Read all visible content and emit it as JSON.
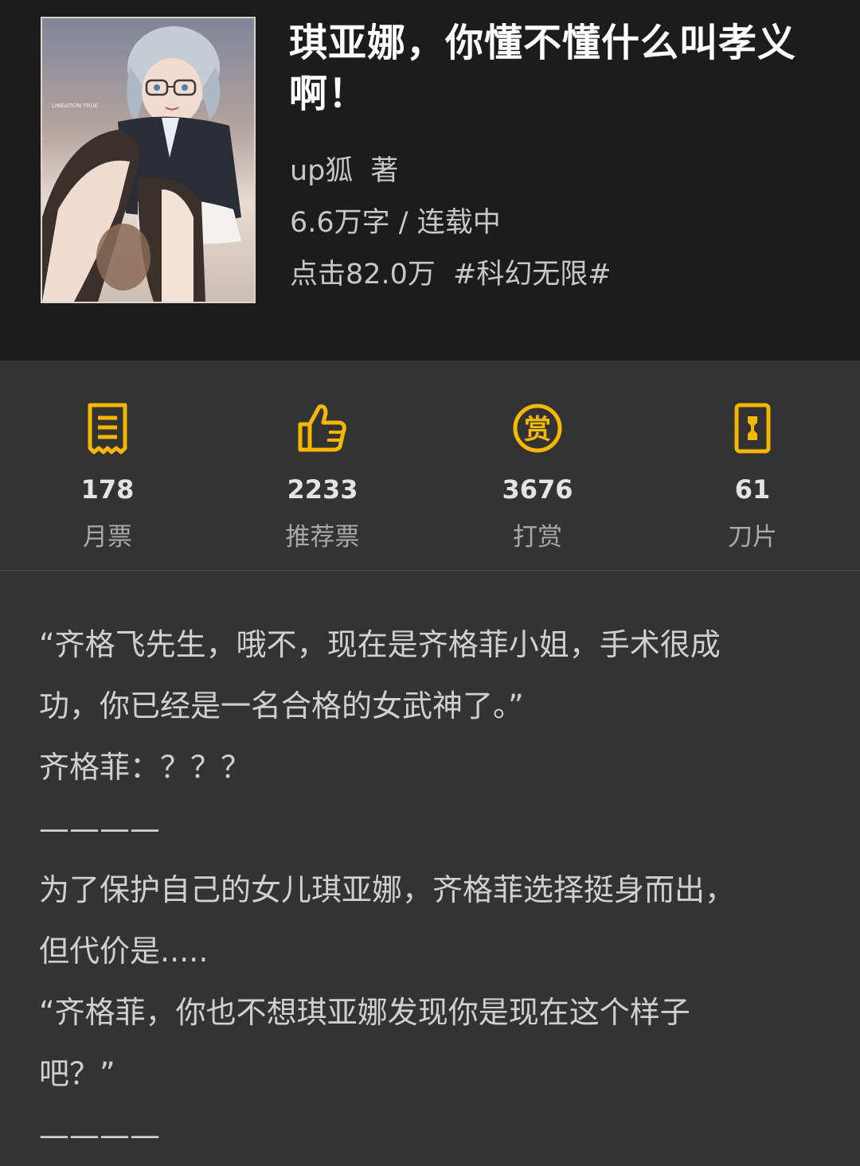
{
  "book": {
    "title_line1": "琪亚娜，你懂不懂什么叫孝义",
    "title_line2": "啊！",
    "author": "up狐",
    "author_suffix": "著",
    "words_status": "6.6万字 / 连载中",
    "clicks": "点击82.0万",
    "genre_tag": "#科幻无限#",
    "cover_text": "LINEATION TRUE"
  },
  "stats": [
    {
      "value": "178",
      "label": "月票",
      "icon": "monthly-ticket-icon"
    },
    {
      "value": "2233",
      "label": "推荐票",
      "icon": "thumbs-up-icon"
    },
    {
      "value": "3676",
      "label": "打赏",
      "icon": "reward-coin-icon"
    },
    {
      "value": "61",
      "label": "刀片",
      "icon": "blade-icon"
    }
  ],
  "description": [
    "“齐格飞先生，哦不，现在是齐格菲小姐，手术很成",
    "功，你已经是一名合格的女武神了。”",
    "齐格菲：？？？",
    "————",
    "为了保护自己的女儿琪亚娜，齐格菲选择挺身而出，",
    "但代价是.....",
    "“齐格菲，你也不想琪亚娜发现你是现在这个样子",
    "吧？”",
    "————"
  ],
  "colors": {
    "accent": "#f5b800",
    "header_bg": "#1c1c1c",
    "body_bg": "#333333"
  }
}
